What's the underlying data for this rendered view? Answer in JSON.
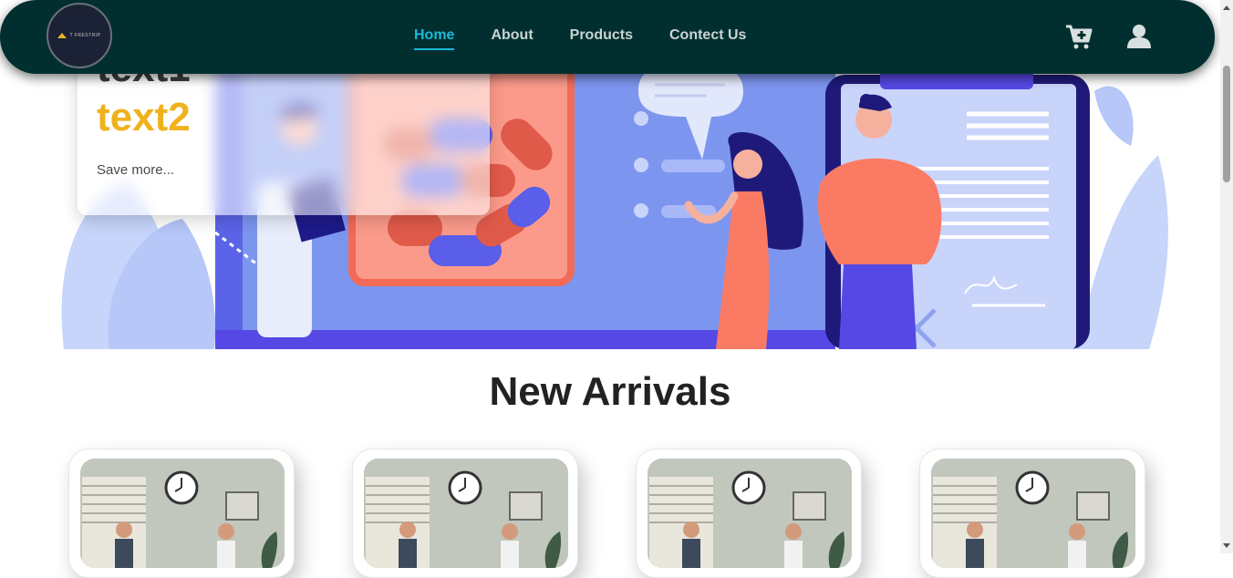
{
  "nav": {
    "logo_text": "T FRESTRIP",
    "links": [
      {
        "label": "Home",
        "active": true
      },
      {
        "label": "About",
        "active": false
      },
      {
        "label": "Products",
        "active": false
      },
      {
        "label": "Contect Us",
        "active": false
      }
    ],
    "icons": [
      "cart-plus-icon",
      "user-icon"
    ]
  },
  "hero": {
    "text1": "text1",
    "text2": "text2",
    "save_more": "Save more..."
  },
  "new_arrivals": {
    "title": "New Arrivals",
    "card_count": 4
  },
  "colors": {
    "navbar_bg": "#012f2f",
    "active_link": "#1db7d6",
    "accent_yellow": "#f0b21c",
    "hero_blue": "#7c96f0",
    "hero_coral": "#fb7a64"
  }
}
